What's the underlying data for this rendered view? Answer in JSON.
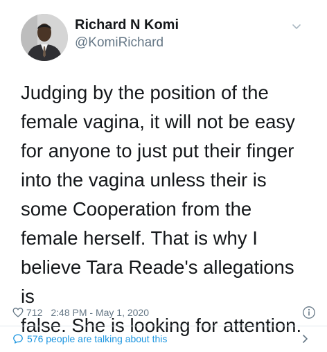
{
  "author": {
    "name": "Richard N Komi",
    "handle": "@KomiRichard"
  },
  "tweet": {
    "text": "Judging by the position of the\nfemale vagina, it will not be easy\nfor anyone to just put their finger\ninto the vagina unless their is\nsome Cooperation from the\nfemale herself. That is why I\nbelieve Tara Reade's allegations is\nfalse. She is looking for attention.",
    "likes": "712",
    "timestamp": "2:48 PM - May 1, 2020"
  },
  "conversation": {
    "label": "576 people are talking about this"
  },
  "icons": {
    "chevron": "chevron-down-icon",
    "like": "heart-icon",
    "info": "info-icon",
    "reply_bubble": "speech-bubble-icon",
    "next": "chevron-right-icon"
  },
  "colors": {
    "text": "#14171a",
    "muted": "#657786",
    "link": "#1b95e0",
    "divider": "#e1e8ed"
  }
}
